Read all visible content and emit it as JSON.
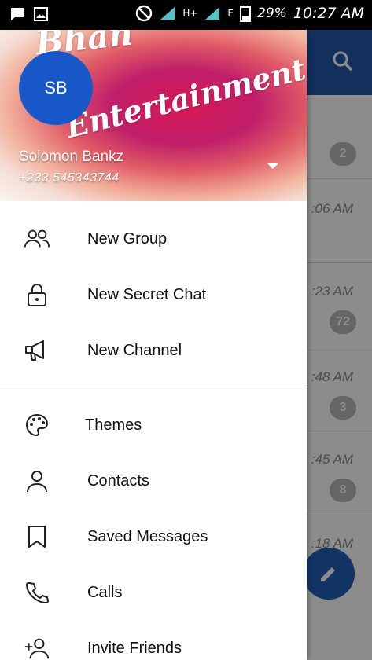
{
  "status_bar": {
    "battery": "29%",
    "time": "10:27 AM",
    "network_h": "H+",
    "network_e": "E"
  },
  "chat_list": {
    "rows": [
      {
        "time": "",
        "badge": "2"
      },
      {
        "time": ":06 AM",
        "badge": ""
      },
      {
        "time": ":23 AM",
        "badge": "72"
      },
      {
        "time": ":48 AM",
        "badge": "3"
      },
      {
        "time": ":45 AM",
        "badge": "8"
      },
      {
        "time": ":18 AM",
        "badge": ""
      }
    ]
  },
  "drawer": {
    "header": {
      "avatar_initials": "SB",
      "name": "Solomon Bankz",
      "phone": "+233 545343744",
      "cover_text_1": "Bhan",
      "cover_text_2": "Entertainment"
    },
    "items": [
      {
        "label": "New Group",
        "icon": "group-icon"
      },
      {
        "label": "New Secret Chat",
        "icon": "lock-icon"
      },
      {
        "label": "New Channel",
        "icon": "megaphone-icon"
      },
      {
        "label": "Themes",
        "icon": "palette-icon"
      },
      {
        "label": "Contacts",
        "icon": "person-icon"
      },
      {
        "label": "Saved Messages",
        "icon": "bookmark-icon"
      },
      {
        "label": "Calls",
        "icon": "phone-icon"
      },
      {
        "label": "Invite Friends",
        "icon": "add-person-icon"
      }
    ]
  },
  "colors": {
    "header_blue": "#2457a8",
    "avatar_blue": "#1857c7",
    "fab_blue": "#1f5fb8"
  }
}
